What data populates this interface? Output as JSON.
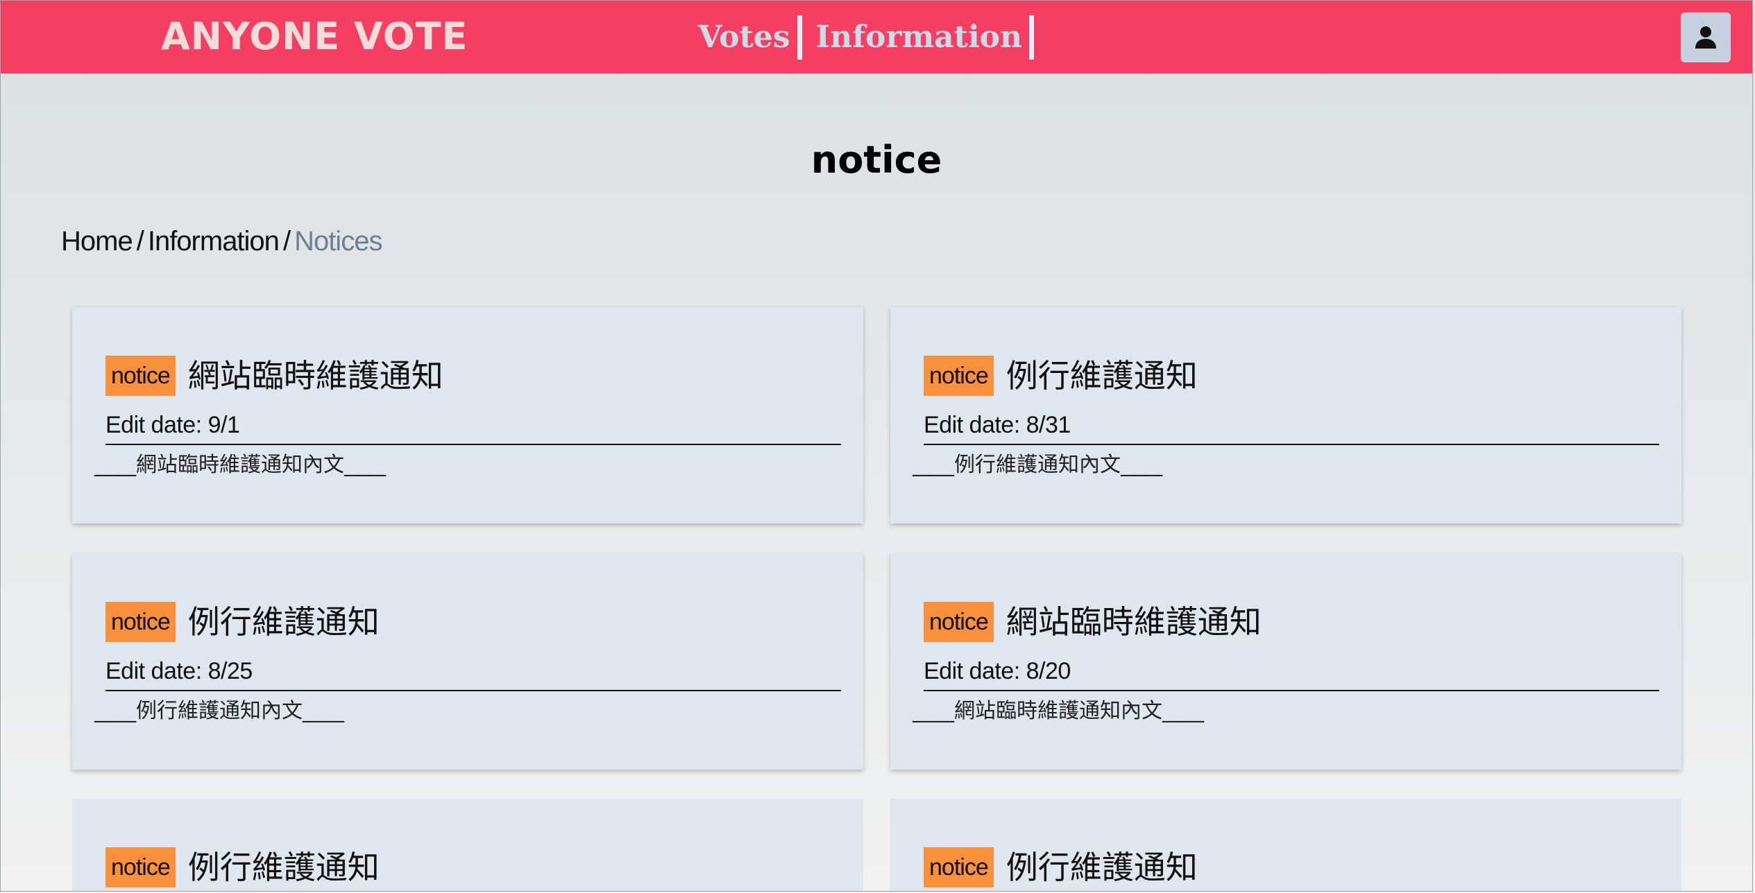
{
  "navbar": {
    "brand": "ANYONE VOTE",
    "links": [
      {
        "label": "Votes"
      },
      {
        "label": "Information"
      }
    ],
    "user_icon": "user-icon"
  },
  "page": {
    "title": "notice"
  },
  "breadcrumb": {
    "items": [
      "Home",
      "Information"
    ],
    "separator": "/",
    "current": "Notices"
  },
  "notices": [
    {
      "badge": "notice",
      "title": "網站臨時維護通知",
      "date_label": "Edit date: 9/1",
      "body": "____網站臨時維護通知內文____"
    },
    {
      "badge": "notice",
      "title": "例行維護通知",
      "date_label": "Edit date: 8/31",
      "body": "____例行維護通知內文____"
    },
    {
      "badge": "notice",
      "title": "例行維護通知",
      "date_label": "Edit date: 8/25",
      "body": "____例行維護通知內文____"
    },
    {
      "badge": "notice",
      "title": "網站臨時維護通知",
      "date_label": "Edit date: 8/20",
      "body": "____網站臨時維護通知內文____"
    },
    {
      "badge": "notice",
      "title": "例行維護通知",
      "date_label": "",
      "body": ""
    },
    {
      "badge": "notice",
      "title": "例行維護通知",
      "date_label": "",
      "body": ""
    }
  ],
  "colors": {
    "navbar_bg": "#f43f62",
    "badge_bg": "#f9913c",
    "card_bg": "#e0e6ee",
    "breadcrumb_active": "#6e7f93"
  }
}
